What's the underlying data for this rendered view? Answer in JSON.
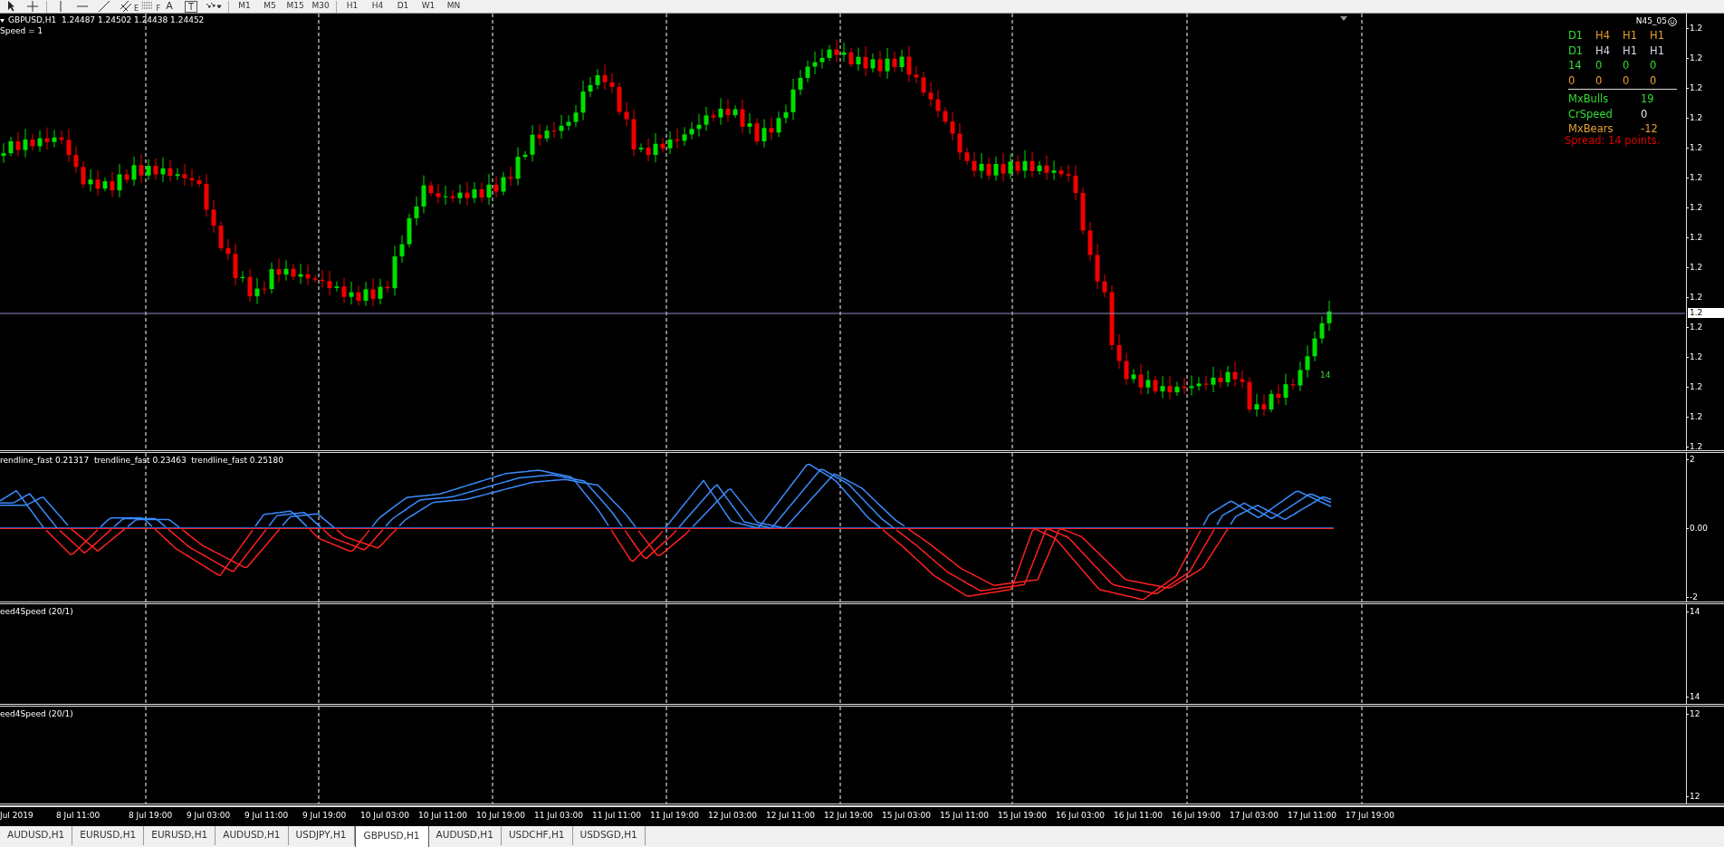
{
  "toolbar": {
    "channel_tool_letter": "E",
    "fibo_tool_letter": "F",
    "text_tool": "A",
    "label_tool": "T",
    "minute_periods": [
      "M1",
      "M5",
      "M15",
      "M30"
    ],
    "hour_periods": [
      "H1",
      "H4",
      "D1",
      "W1",
      "MN"
    ]
  },
  "chart": {
    "symbol_line": "GBPUSD,H1  1.24487 1.24502 1.24438 1.24452",
    "speed_label": "Speed = 1",
    "bar_label": "14",
    "current_price": "1.2",
    "price_labels": [
      "1.2",
      "1.2",
      "1.2",
      "1.2",
      "1.2",
      "1.2",
      "1.2",
      "1.2",
      "1.2",
      "1.2",
      "1.2",
      "1.2",
      "1.2",
      "1.2",
      "1.2"
    ]
  },
  "panel": {
    "title": "N45_05",
    "grid": [
      [
        {
          "text": "D1",
          "color": "#33dd33"
        },
        {
          "text": "H4",
          "color": "#e8a030"
        },
        {
          "text": "H1",
          "color": "#e8a030"
        },
        {
          "text": "H1",
          "color": "#e8a030"
        }
      ],
      [
        {
          "text": "D1",
          "color": "#33dd33"
        },
        {
          "text": "H4",
          "color": "#d8d8e8"
        },
        {
          "text": "H1",
          "color": "#d8d8e8"
        },
        {
          "text": "H1",
          "color": "#d8d8e8"
        }
      ],
      [
        {
          "text": "14",
          "color": "#33dd33"
        },
        {
          "text": "0",
          "color": "#33dd33"
        },
        {
          "text": "0",
          "color": "#33dd33"
        },
        {
          "text": "0",
          "color": "#33dd33"
        }
      ],
      [
        {
          "text": "0",
          "color": "#e8a030"
        },
        {
          "text": "0",
          "color": "#e8a030"
        },
        {
          "text": "0",
          "color": "#e8a030"
        },
        {
          "text": "0",
          "color": "#e8a030"
        }
      ]
    ],
    "stats": [
      {
        "label": {
          "text": "MxBulls",
          "color": "#33dd33"
        },
        "value": {
          "text": "19",
          "color": "#33dd33"
        }
      },
      {
        "label": {
          "text": "CrSpeed",
          "color": "#33dd33"
        },
        "value": {
          "text": "0",
          "color": "#e8e8f0"
        }
      },
      {
        "label": {
          "text": "MxBears",
          "color": "#e8a030"
        },
        "value": {
          "text": "-12",
          "color": "#e8a030"
        }
      }
    ],
    "spread": "Spread: 14 points."
  },
  "indicator": {
    "label": "rendline_fast 0.21317  trendline_fast 0.23463  trendline_fast 0.25180",
    "axis_labels": [
      "2",
      "0.00",
      "-2"
    ]
  },
  "subwindows": [
    {
      "label": "eed4Speed (20/1)",
      "axis_labels": [
        "14",
        "14"
      ]
    },
    {
      "label": "eed4Speed (20/1)",
      "axis_labels": [
        "12",
        "12"
      ]
    }
  ],
  "time_axis": [
    "Jul 2019",
    "8 Jul 11:00",
    "8 Jul 19:00",
    "9 Jul 03:00",
    "9 Jul 11:00",
    "9 Jul 19:00",
    "10 Jul 03:00",
    "10 Jul 11:00",
    "10 Jul 19:00",
    "11 Jul 03:00",
    "11 Jul 11:00",
    "11 Jul 19:00",
    "12 Jul 03:00",
    "12 Jul 11:00",
    "12 Jul 19:00",
    "15 Jul 03:00",
    "15 Jul 11:00",
    "15 Jul 19:00",
    "16 Jul 03:00",
    "16 Jul 11:00",
    "16 Jul 19:00",
    "17 Jul 03:00",
    "17 Jul 11:00",
    "17 Jul 19:00"
  ],
  "tabs": [
    {
      "label": "AUDUSD,H1",
      "selected": false
    },
    {
      "label": "EURUSD,H1",
      "selected": false
    },
    {
      "label": "EURUSD,H1",
      "selected": false
    },
    {
      "label": "AUDUSD,H1",
      "selected": false
    },
    {
      "label": "USDJPY,H1",
      "selected": false
    },
    {
      "label": "GBPUSD,H1",
      "selected": true
    },
    {
      "label": "AUDUSD,H1",
      "selected": false
    },
    {
      "label": "USDCHF,H1",
      "selected": false
    },
    {
      "label": "USDSGD,H1",
      "selected": false
    }
  ]
}
